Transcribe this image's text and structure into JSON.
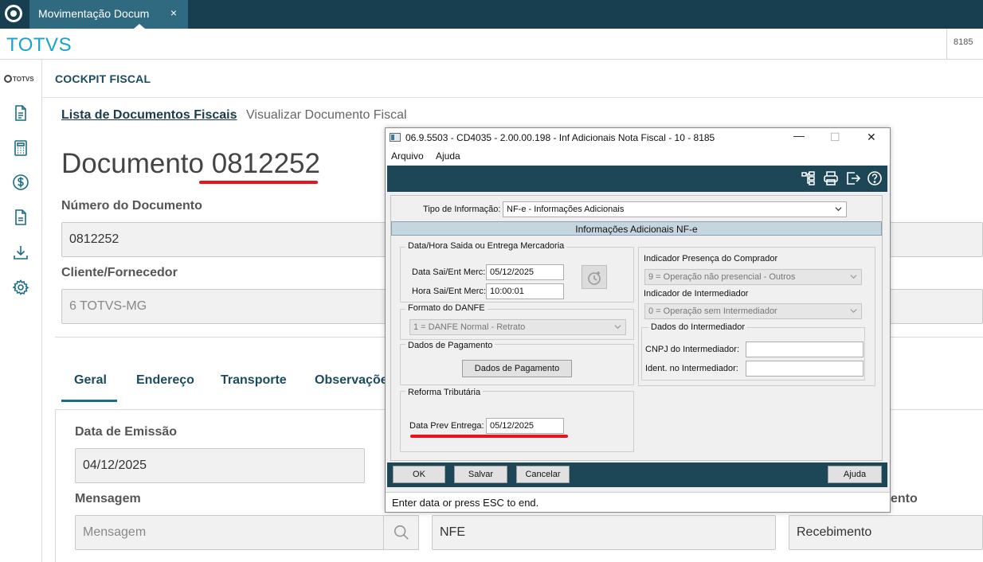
{
  "topbar": {
    "tab_label": "Movimentação Docum",
    "tab_close": "×"
  },
  "brand": {
    "name": "TOTVS",
    "user_code": "8185"
  },
  "sidenav": {
    "logo_text": "TOTVS",
    "items": [
      {
        "icon": "document-icon"
      },
      {
        "icon": "calculator-icon"
      },
      {
        "icon": "dollar-icon"
      },
      {
        "icon": "report-icon"
      },
      {
        "icon": "download-icon"
      },
      {
        "icon": "gear-icon"
      }
    ]
  },
  "module": {
    "title": "COCKPIT FISCAL"
  },
  "breadcrumb": {
    "parent": "Lista de Documentos Fiscais",
    "separator": "›",
    "current": "Visualizar Documento Fiscal"
  },
  "document": {
    "title": "Documento 0812252",
    "numero_label": "Número do Documento",
    "numero_value": "0812252",
    "cliente_label": "Cliente/Fornecedor",
    "cliente_value": "6  TOTVS-MG"
  },
  "page_tabs": [
    "Geral",
    "Endereço",
    "Transporte",
    "Observações"
  ],
  "form": {
    "emissao_label": "Data de Emissão",
    "emissao_value": "04/12/2025",
    "mensagem_label": "Mensagem",
    "mensagem_placeholder": "Mensagem",
    "especie_value": "NFE",
    "tipo_label_partial": "ento",
    "tipo_value": "Recebimento"
  },
  "dialog": {
    "title": "06.9.5503 - CD4035 - 2.00.00.198 - Inf Adicionais Nota Fiscal - 10 - 8185",
    "win_minimize": "—",
    "win_maximize": "☐",
    "win_close": "✕",
    "menu": [
      "Arquivo",
      "Ajuda"
    ],
    "tipo_info_label": "Tipo de Informação:",
    "tipo_info_value": "NF-e - Informações Adicionais",
    "section_header": "Informações Adicionais NF-e",
    "grp_datahora_title": "Data/Hora Saida ou Entrega Mercadoria",
    "data_sai_label": "Data Sai/Ent Merc:",
    "data_sai_value": "05/12/2025",
    "hora_sai_label": "Hora Sai/Ent Merc:",
    "hora_sai_value": "10:00:01",
    "grp_danfe_title": "Formato do DANFE",
    "danfe_value": "1 = DANFE Normal - Retrato",
    "grp_pagamento_title": "Dados de Pagamento",
    "pagamento_button": "Dados de Pagamento",
    "grp_reforma_title": "Reforma Tributária",
    "data_prev_label": "Data Prev Entrega:",
    "data_prev_value": "05/12/2025",
    "presenca_label": "Indicador Presença do Comprador",
    "presenca_value": "9 = Operação não presencial - Outros",
    "intermediador_label": "Indicador de Intermediador",
    "intermediador_value": "0 = Operação sem Intermediador",
    "grp_dados_inter_title": "Dados do Intermediador",
    "cnpj_label": "CNPJ do Intermediador:",
    "ident_label": "Ident. no Intermediador:",
    "buttons": {
      "ok": "OK",
      "salvar": "Salvar",
      "cancelar": "Cancelar",
      "ajuda": "Ajuda"
    },
    "status": "Enter data or press ESC to end."
  },
  "colors": {
    "topbar": "#183f4f",
    "brand": "#1aa3c9",
    "accent_red": "#e8131b",
    "dialog_toolbar": "#1d4756"
  }
}
